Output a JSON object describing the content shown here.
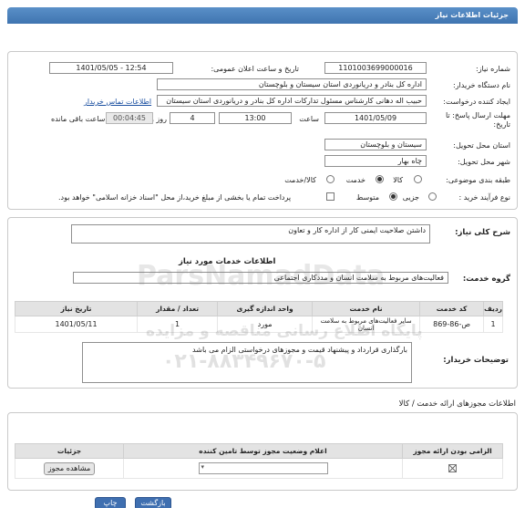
{
  "header": {
    "title": "جزئیات اطلاعات نیاز"
  },
  "form": {
    "need_number_label": "شماره نیاز:",
    "need_number": "1101003699000016",
    "announce_label": "تاریخ و ساعت اعلان عمومی:",
    "announce_value": "1401/05/05 - 12:54",
    "buyer_org_label": "نام دستگاه خریدار:",
    "buyer_org": "اداره کل بنادر و دریانوردی استان سیستان و بلوچستان",
    "creator_label": "ایجاد کننده درخواست:",
    "creator": "حبیب اله دهانی کارشناس مسئول تدارکات اداره کل بنادر و دریانوردی استان سیستان",
    "contact_link": "اطلاعات تماس خریدار",
    "deadline_label": "مهلت ارسال پاسخ: تا",
    "deadline_label2": "تاریخ:",
    "deadline_date": "1401/05/09",
    "time_label": "ساعت",
    "deadline_time": "13:00",
    "days_value": "4",
    "days_label": "روز و",
    "remaining_time": "00:04:45",
    "remaining_label": "ساعت باقی مانده",
    "delivery_province_label": "استان محل تحویل:",
    "delivery_province": "سیستان و بلوچستان",
    "delivery_city_label": "شهر محل تحویل:",
    "delivery_city": "چاه بهار",
    "category_label": "طبقه بندی موضوعی:",
    "category_options": [
      "کالا",
      "خدمت",
      "کالا/خدمت"
    ],
    "category_selected": "خدمت",
    "process_label": "نوع فرآیند خرید :",
    "process_options": [
      "جزیی",
      "متوسط"
    ],
    "process_selected": "متوسط",
    "payment_note": "پرداخت تمام یا بخشی از مبلغ خرید،از محل \"اسناد خزانه اسلامی\" خواهد بود."
  },
  "need_summary": {
    "label": "شرح کلی نیاز:",
    "value": "داشتن صلاحیت ایمنی کار از اداره کار و تعاون"
  },
  "services_section": {
    "title": "اطلاعات خدمات مورد نیاز",
    "group_label": "گروه خدمت:",
    "group_value": "فعالیت‌های مربوط به سلامت انسان و مددکاری اجتماعی"
  },
  "services_table": {
    "headers": [
      "ردیف",
      "کد خدمت",
      "نام خدمت",
      "واحد اندازه گیری",
      "تعداد / مقدار",
      "تاریخ نیاز"
    ],
    "rows": [
      [
        "1",
        "ص-86-869",
        "سایر فعالیت‌های مربوط به سلامت انسان",
        "مورد",
        "1",
        "1401/05/11"
      ]
    ]
  },
  "buyer_notes": {
    "label": "توضیحات خریدار:",
    "value": "بارگذاری قرارداد و پیشنهاد قیمت و مجوزهای درخواستی الزام می باشد"
  },
  "permits_section": {
    "title": "اطلاعات مجوزهای ارائه خدمت / کالا",
    "headers": [
      "الزامی بودن ارائه مجوز",
      "اعلام وضعیت مجوز توسط تامین کننده",
      "جزئیات"
    ],
    "view_button": "مشاهده مجوز"
  },
  "footer": {
    "print": "چاپ",
    "back": "بازگشت"
  },
  "watermark": {
    "line1": "ParsNamadData",
    "line2": "پایگاه اطلاع رسانی مناقصه و مزایده",
    "phone": "۰۲۱-۸۸۳۴۹۶۷۰-۵"
  }
}
